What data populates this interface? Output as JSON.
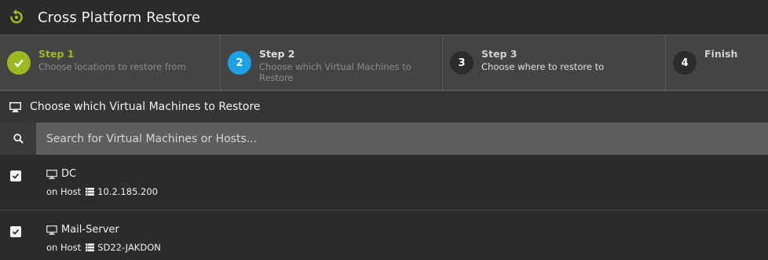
{
  "app": {
    "title": "Cross Platform Restore",
    "icon": "restore-icon",
    "accent": "#9cb91f"
  },
  "stepper": {
    "steps": [
      {
        "number": "1",
        "title": "Step 1",
        "description": "Choose locations to restore from",
        "state": "done"
      },
      {
        "number": "2",
        "title": "Step 2",
        "description": "Choose which Virtual Machines to Restore",
        "state": "active"
      },
      {
        "number": "3",
        "title": "Step 3",
        "description": "Choose where to restore to",
        "state": "pending"
      },
      {
        "number": "4",
        "title": "Finish",
        "description": "",
        "state": "pending"
      }
    ],
    "colors": {
      "done": "#9cb91f",
      "active": "#1da1e6",
      "pending": "#2c2c2c"
    }
  },
  "section": {
    "icon": "monitor-icon",
    "label": "Choose which Virtual Machines to Restore"
  },
  "search": {
    "icon": "search-icon",
    "placeholder": "Search for Virtual Machines or Hosts...",
    "value": ""
  },
  "vms": [
    {
      "name": "DC",
      "host_prefix": "on Host",
      "host": "10.2.185.200",
      "checked": true
    },
    {
      "name": "Mail-Server",
      "host_prefix": "on Host",
      "host": "SD22-JAKDON",
      "checked": true
    }
  ]
}
